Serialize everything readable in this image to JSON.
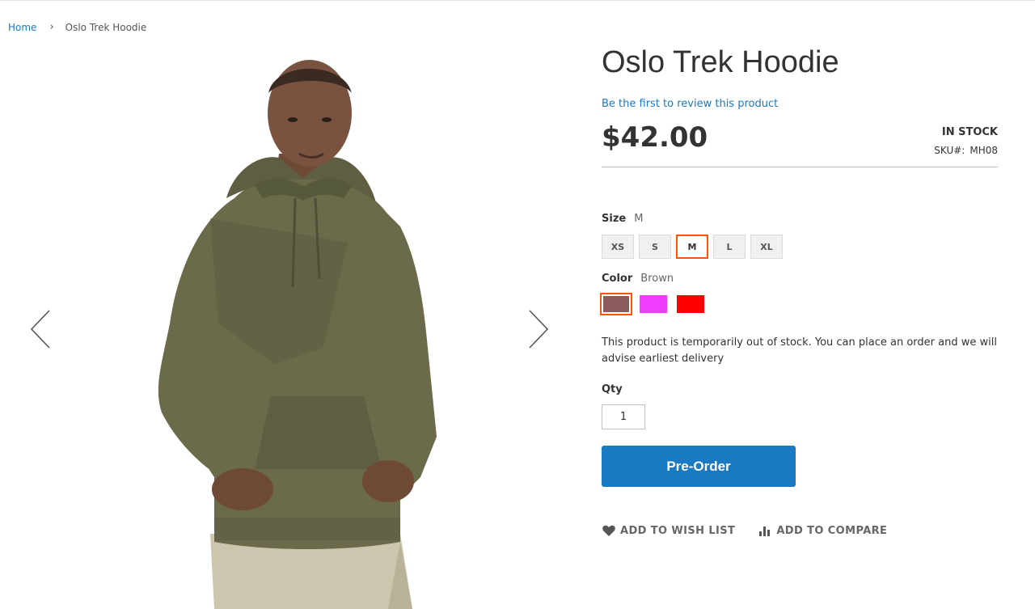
{
  "breadcrumbs": {
    "home": "Home",
    "separator": "›",
    "current": "Oslo Trek Hoodie"
  },
  "gallery": {
    "prev_icon": "chevron-left-icon",
    "next_icon": "chevron-right-icon",
    "image_alt": "Oslo Trek Hoodie"
  },
  "product": {
    "title": "Oslo Trek Hoodie",
    "review_link": "Be the first to review this product",
    "price": "$42.00",
    "stock_status": "In stock",
    "sku_label": "SKU#:",
    "sku_value": "MH08"
  },
  "options": {
    "size": {
      "label": "Size",
      "selected": "M",
      "values": [
        "XS",
        "S",
        "M",
        "L",
        "XL"
      ]
    },
    "color": {
      "label": "Color",
      "selected": "Brown",
      "swatches": [
        {
          "name": "Brown",
          "hex": "#8b5a5a"
        },
        {
          "name": "Purple",
          "hex": "#ef3dff"
        },
        {
          "name": "Red",
          "hex": "#ff0000"
        }
      ]
    }
  },
  "stock_message": "This product is temporarily out of stock. You can place an order and we will advise earliest delivery",
  "qty": {
    "label": "Qty",
    "value": "1"
  },
  "preorder_label": "Pre-Order",
  "actions": {
    "wishlist_label": "Add to Wish List",
    "compare_label": "Add to Compare"
  },
  "colors": {
    "accent": "#1979c3",
    "selected_border": "#ff5501"
  }
}
